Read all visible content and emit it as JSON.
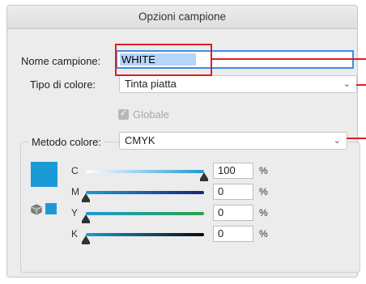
{
  "dialog": {
    "title": "Opzioni campione"
  },
  "swatch_name": {
    "label": "Nome campione:",
    "value": "WHITE"
  },
  "color_type": {
    "label": "Tipo di colore:",
    "value": "Tinta piatta"
  },
  "global": {
    "label": "Globale",
    "checked": true
  },
  "color_mode": {
    "label": "Metodo colore:",
    "value": "CMYK"
  },
  "channels": [
    {
      "letter": "C",
      "value": "100",
      "unit": "%",
      "level": 1.0
    },
    {
      "letter": "M",
      "value": "0",
      "unit": "%",
      "level": 0.0
    },
    {
      "letter": "Y",
      "value": "0",
      "unit": "%",
      "level": 0.0
    },
    {
      "letter": "K",
      "value": "0",
      "unit": "%",
      "level": 0.0
    }
  ],
  "colors": {
    "swatch": "#1c9ad6",
    "highlight": "#b5d5fb",
    "callout": "#e01d25",
    "focus": "#3b8ee6"
  },
  "icons": [
    "checkbox-checked-icon",
    "out-of-gamut-cube-icon",
    "chevron-down-icon",
    "slider-thumb-icon"
  ]
}
